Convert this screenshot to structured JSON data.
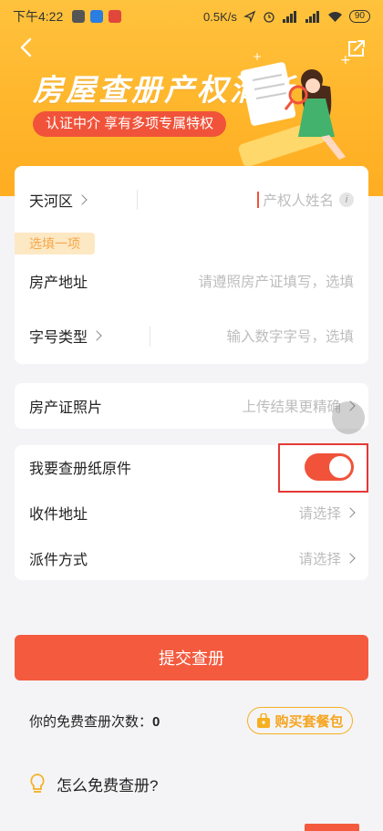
{
  "statusbar": {
    "time": "下午4:22",
    "speed": "0.5K/s",
    "battery": "90"
  },
  "hero": {
    "title": "房屋查册产权清晰",
    "pill": "认证中介 享有多项专属特权"
  },
  "card1": {
    "district": "天河区",
    "owner_placeholder": "产权人姓名",
    "optional_tag": "选填一项",
    "address_label": "房产地址",
    "address_placeholder": "请遵照房产证填写，选填",
    "number_type_label": "字号类型",
    "number_placeholder": "输入数字字号，选填"
  },
  "card2": {
    "label": "房产证照片",
    "hint": "上传结果更精确"
  },
  "card3": {
    "paper_label": "我要查册纸原件",
    "paper_toggle_on": true,
    "receive_label": "收件地址",
    "receive_value": "请选择",
    "delivery_label": "派件方式",
    "delivery_value": "请选择"
  },
  "submit_label": "提交查册",
  "free_count_label": "你的免费查册次数：",
  "free_count": "0",
  "buy_label": "购买套餐包",
  "faq_label": "怎么免费查册?",
  "colors": {
    "accent": "#f45a3e",
    "hero": "#ffb52a",
    "tag_bg": "#fde8c4"
  }
}
